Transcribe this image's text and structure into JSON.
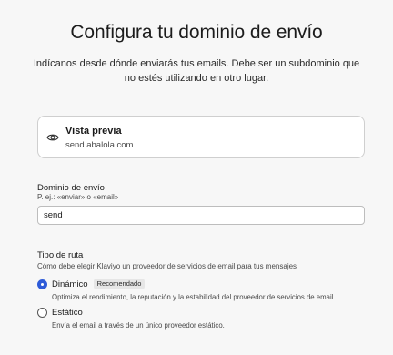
{
  "header": {
    "title": "Configura tu dominio de envío",
    "subtitle": "Indícanos desde dónde enviarás tus emails. Debe ser un subdominio que no estés utilizando en otro lugar."
  },
  "preview": {
    "icon": "eye-icon",
    "label": "Vista previa",
    "domain": "send.abalola.com"
  },
  "domain_field": {
    "label": "Dominio de envío",
    "hint": "P. ej.: «enviar» o «email»",
    "value": "send"
  },
  "route": {
    "label": "Tipo de ruta",
    "hint": "Cómo debe elegir Klaviyo un proveedor de servicios de email para tus mensajes",
    "options": [
      {
        "label": "Dinámico",
        "badge": "Recomendado",
        "description": "Optimiza el rendimiento, la reputación y la estabilidad del proveedor de servicios de email.",
        "selected": true
      },
      {
        "label": "Estático",
        "description": "Envía el email a través de un único proveedor estático.",
        "selected": false
      }
    ]
  },
  "colors": {
    "accent": "#2e5bd8",
    "background": "#f7f7f7"
  }
}
